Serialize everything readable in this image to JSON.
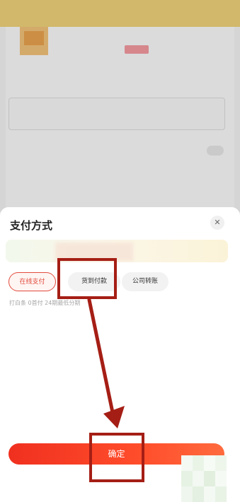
{
  "sheet": {
    "title": "支付方式",
    "close_icon": "close-icon",
    "options": [
      {
        "label": "在线支付",
        "selected": true
      },
      {
        "label": "货到付款",
        "selected": false
      },
      {
        "label": "公司转账",
        "selected": false
      }
    ],
    "note": "打白条 0首付 24期最低分期",
    "confirm_label": "确定"
  },
  "colors": {
    "accent": "#e14b3c",
    "confirm_start": "#f0301f",
    "confirm_end": "#ff6a3d",
    "annotation": "#a51e15"
  }
}
